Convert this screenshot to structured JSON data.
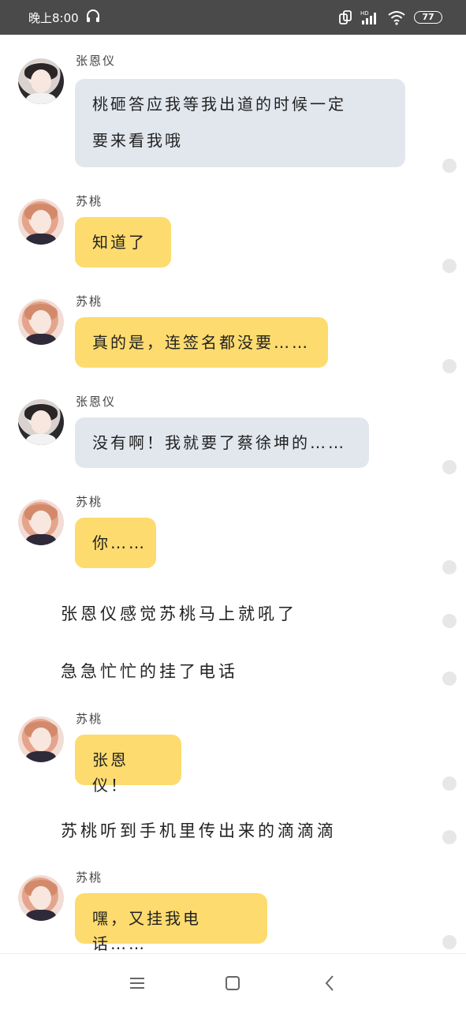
{
  "status_bar": {
    "time": "晚上8:00",
    "battery": "77"
  },
  "chat": {
    "messages": [
      {
        "sender": "张恩仪",
        "side": "gray",
        "lines": [
          "桃砸答应我等我出道的时候一定",
          "要来看我哦"
        ]
      },
      {
        "sender": "苏桃",
        "side": "yellow",
        "lines": [
          "知道了"
        ]
      },
      {
        "sender": "苏桃",
        "side": "yellow",
        "lines": [
          "真的是，连签名都没要……"
        ]
      },
      {
        "sender": "张恩仪",
        "side": "gray",
        "lines": [
          "没有啊！我就要了蔡徐坤的……"
        ]
      },
      {
        "sender": "苏桃",
        "side": "yellow",
        "lines": [
          "你……"
        ]
      },
      {
        "sender": "苏桃",
        "side": "yellow",
        "lines": [
          "张恩仪！"
        ]
      },
      {
        "sender": "苏桃",
        "side": "yellow",
        "lines": [
          "嘿，又挂我电话……"
        ]
      }
    ],
    "narrations": [
      "张恩仪感觉苏桃马上就吼了",
      "急急忙忙的挂了电话",
      "苏桃听到手机里传出来的滴滴滴"
    ]
  },
  "nav": {
    "menu_icon": "menu-icon",
    "home_icon": "home-square-icon",
    "back_icon": "back-chevron-icon"
  }
}
